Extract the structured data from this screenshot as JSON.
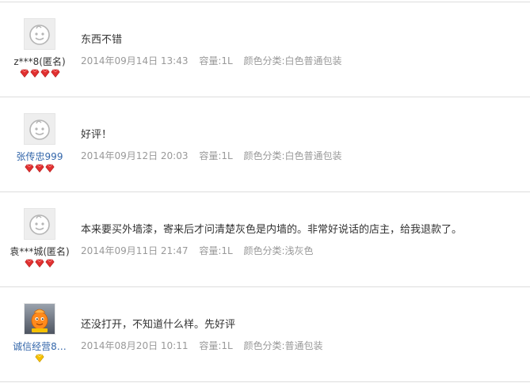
{
  "reviews": [
    {
      "user": "z***8(匿名)",
      "user_is_link": false,
      "avatar": "smiley-face-avatar",
      "level_icon": "red-heart-diamond-icon",
      "level_count": 4,
      "content": "东西不错",
      "date": "2014年09月14日 13:43",
      "capacity": "容量:1L",
      "color": "颜色分类:白色普通包装"
    },
    {
      "user": "张传忠999",
      "user_is_link": true,
      "avatar": "smiley-face-avatar",
      "level_icon": "red-heart-diamond-icon",
      "level_count": 3,
      "content": "好评！",
      "date": "2014年09月12日 20:03",
      "capacity": "容量:1L",
      "color": "颜色分类:白色普通包装"
    },
    {
      "user": "袁***城(匿名)",
      "user_is_link": false,
      "avatar": "smiley-face-avatar",
      "level_icon": "red-heart-diamond-icon",
      "level_count": 3,
      "content": "本来要买外墙漆，寄来后才问清楚灰色是内墙的。非常好说话的店主，给我退款了。",
      "date": "2014年09月11日 21:47",
      "capacity": "容量:1L",
      "color": "颜色分类:浅灰色"
    },
    {
      "user": "诚信经营8…",
      "user_is_link": true,
      "avatar": "orange-mascot-avatar",
      "level_icon": "yellow-diamond-icon",
      "level_count": 1,
      "content": "还没打开，不知道什么样。先好评",
      "date": "2014年08月20日 10:11",
      "capacity": "容量:1L",
      "color": "颜色分类:普通包装"
    }
  ],
  "colors": {
    "text": "#333333",
    "meta": "#999999",
    "link": "#3366aa",
    "divider": "#dddddd",
    "red_gem": "#e03030",
    "yellow_gem": "#f5c000"
  }
}
